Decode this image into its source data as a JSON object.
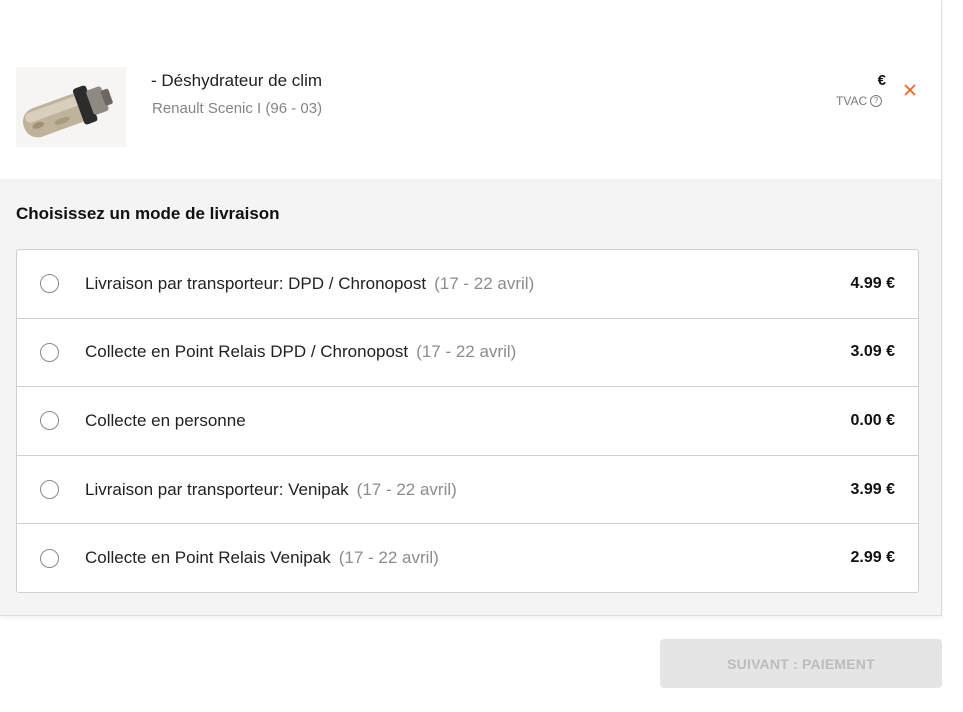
{
  "product": {
    "title": "- Déshydrateur de clim",
    "subtitle": "Renault Scenic I (96 - 03)",
    "currency": "€",
    "tax_label": "TVAC",
    "thumbnail_icon": "product-photo"
  },
  "shipping": {
    "title": "Choisissez un mode de livraison",
    "options": [
      {
        "label": "Livraison par transporteur: DPD / Chronopost",
        "date": "(17 - 22 avril)",
        "price": "4.99 €",
        "selected": false
      },
      {
        "label": "Collecte en Point Relais DPD / Chronopost",
        "date": "(17 - 22 avril)",
        "price": "3.09 €",
        "selected": false
      },
      {
        "label": "Collecte en personne",
        "date": "",
        "price": "0.00 €",
        "selected": false
      },
      {
        "label": "Livraison par transporteur: Venipak",
        "date": "(17 - 22 avril)",
        "price": "3.99 €",
        "selected": false
      },
      {
        "label": "Collecte en Point Relais Venipak",
        "date": "(17 - 22 avril)",
        "price": "2.99 €",
        "selected": false
      }
    ]
  },
  "footer": {
    "next_label": "SUIVANT : PAIEMENT",
    "next_disabled": true
  },
  "colors": {
    "accent": "#e8662c",
    "section_bg": "#f4f4f4",
    "disabled_button_bg": "#e5e5e5"
  }
}
